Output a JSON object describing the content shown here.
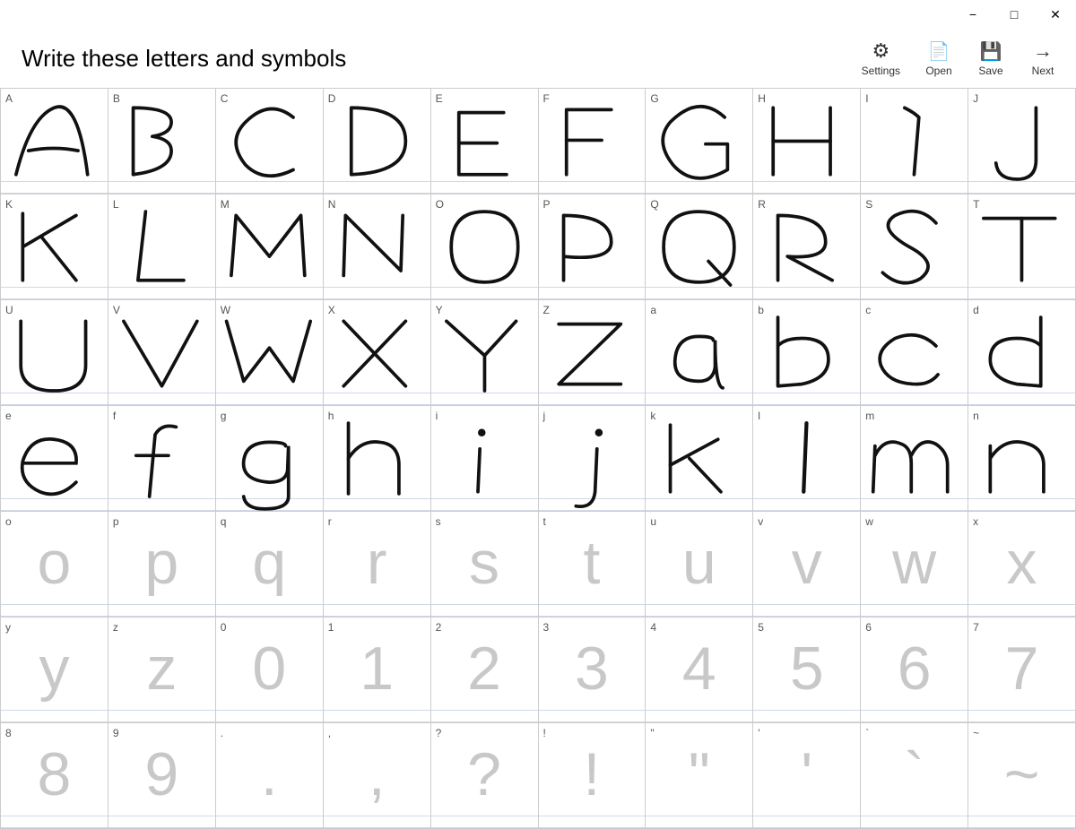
{
  "window": {
    "title": "Write these letters and symbols",
    "controls": {
      "minimize": "−",
      "maximize": "□",
      "close": "✕"
    }
  },
  "toolbar": {
    "items": [
      {
        "id": "settings",
        "label": "Settings",
        "icon": "⚙"
      },
      {
        "id": "open",
        "label": "Open",
        "icon": "📄"
      },
      {
        "id": "save",
        "label": "Save",
        "icon": "💾"
      },
      {
        "id": "next",
        "label": "Next",
        "icon": "→"
      }
    ]
  },
  "cells": [
    {
      "label": "A",
      "char": "A",
      "written": true
    },
    {
      "label": "B",
      "char": "B",
      "written": true
    },
    {
      "label": "C",
      "char": "C",
      "written": true
    },
    {
      "label": "D",
      "char": "D",
      "written": true
    },
    {
      "label": "E",
      "char": "E",
      "written": true
    },
    {
      "label": "F",
      "char": "F",
      "written": true
    },
    {
      "label": "G",
      "char": "G",
      "written": true
    },
    {
      "label": "H",
      "char": "H",
      "written": true
    },
    {
      "label": "I",
      "char": "I",
      "written": true
    },
    {
      "label": "J",
      "char": "J",
      "written": true
    },
    {
      "label": "K",
      "char": "K",
      "written": true
    },
    {
      "label": "L",
      "char": "L",
      "written": true
    },
    {
      "label": "M",
      "char": "M",
      "written": true
    },
    {
      "label": "N",
      "char": "N",
      "written": true
    },
    {
      "label": "O",
      "char": "O",
      "written": true
    },
    {
      "label": "P",
      "char": "P",
      "written": true
    },
    {
      "label": "Q",
      "char": "Q",
      "written": true
    },
    {
      "label": "R",
      "char": "R",
      "written": true
    },
    {
      "label": "S",
      "char": "S",
      "written": true
    },
    {
      "label": "T",
      "char": "T",
      "written": true
    },
    {
      "label": "U",
      "char": "U",
      "written": true
    },
    {
      "label": "V",
      "char": "V",
      "written": true
    },
    {
      "label": "W",
      "char": "W",
      "written": true
    },
    {
      "label": "X",
      "char": "X",
      "written": true
    },
    {
      "label": "Y",
      "char": "Y",
      "written": true
    },
    {
      "label": "Z",
      "char": "Z",
      "written": true
    },
    {
      "label": "a",
      "char": "a",
      "written": true
    },
    {
      "label": "b",
      "char": "b",
      "written": true
    },
    {
      "label": "c",
      "char": "c",
      "written": true
    },
    {
      "label": "d",
      "char": "d",
      "written": true
    },
    {
      "label": "e",
      "char": "e",
      "written": true
    },
    {
      "label": "f",
      "char": "f",
      "written": true
    },
    {
      "label": "g",
      "char": "g",
      "written": true
    },
    {
      "label": "h",
      "char": "h",
      "written": true
    },
    {
      "label": "i",
      "char": "i",
      "written": true
    },
    {
      "label": "j",
      "char": "j",
      "written": true
    },
    {
      "label": "k",
      "char": "k",
      "written": true
    },
    {
      "label": "l",
      "char": "l",
      "written": true
    },
    {
      "label": "m",
      "char": "m",
      "written": true
    },
    {
      "label": "n",
      "char": "n",
      "written": true
    },
    {
      "label": "o",
      "char": "o",
      "written": false
    },
    {
      "label": "p",
      "char": "p",
      "written": false
    },
    {
      "label": "q",
      "char": "q",
      "written": false
    },
    {
      "label": "r",
      "char": "r",
      "written": false
    },
    {
      "label": "s",
      "char": "s",
      "written": false
    },
    {
      "label": "t",
      "char": "t",
      "written": false
    },
    {
      "label": "u",
      "char": "u",
      "written": false
    },
    {
      "label": "v",
      "char": "v",
      "written": false
    },
    {
      "label": "w",
      "char": "w",
      "written": false
    },
    {
      "label": "x",
      "char": "x",
      "written": false
    },
    {
      "label": "y",
      "char": "y",
      "written": false
    },
    {
      "label": "z",
      "char": "z",
      "written": false
    },
    {
      "label": "0",
      "char": "0",
      "written": false
    },
    {
      "label": "1",
      "char": "1",
      "written": false
    },
    {
      "label": "2",
      "char": "2",
      "written": false
    },
    {
      "label": "3",
      "char": "3",
      "written": false
    },
    {
      "label": "4",
      "char": "4",
      "written": false
    },
    {
      "label": "5",
      "char": "5",
      "written": false
    },
    {
      "label": "6",
      "char": "6",
      "written": false
    },
    {
      "label": "7",
      "char": "7",
      "written": false
    },
    {
      "label": "8",
      "char": "8",
      "written": false
    },
    {
      "label": "9",
      "char": "9",
      "written": false
    },
    {
      "label": ".",
      "char": ".",
      "written": false
    },
    {
      "label": ",",
      "char": ",",
      "written": false
    },
    {
      "label": "?",
      "char": "?",
      "written": false
    },
    {
      "label": "!",
      "char": "!",
      "written": false
    },
    {
      "label": "\"",
      "char": "\"",
      "written": false
    },
    {
      "label": "'",
      "char": "'",
      "written": false
    },
    {
      "label": "`",
      "char": "`",
      "written": false
    },
    {
      "label": "~",
      "char": "~",
      "written": false
    }
  ]
}
